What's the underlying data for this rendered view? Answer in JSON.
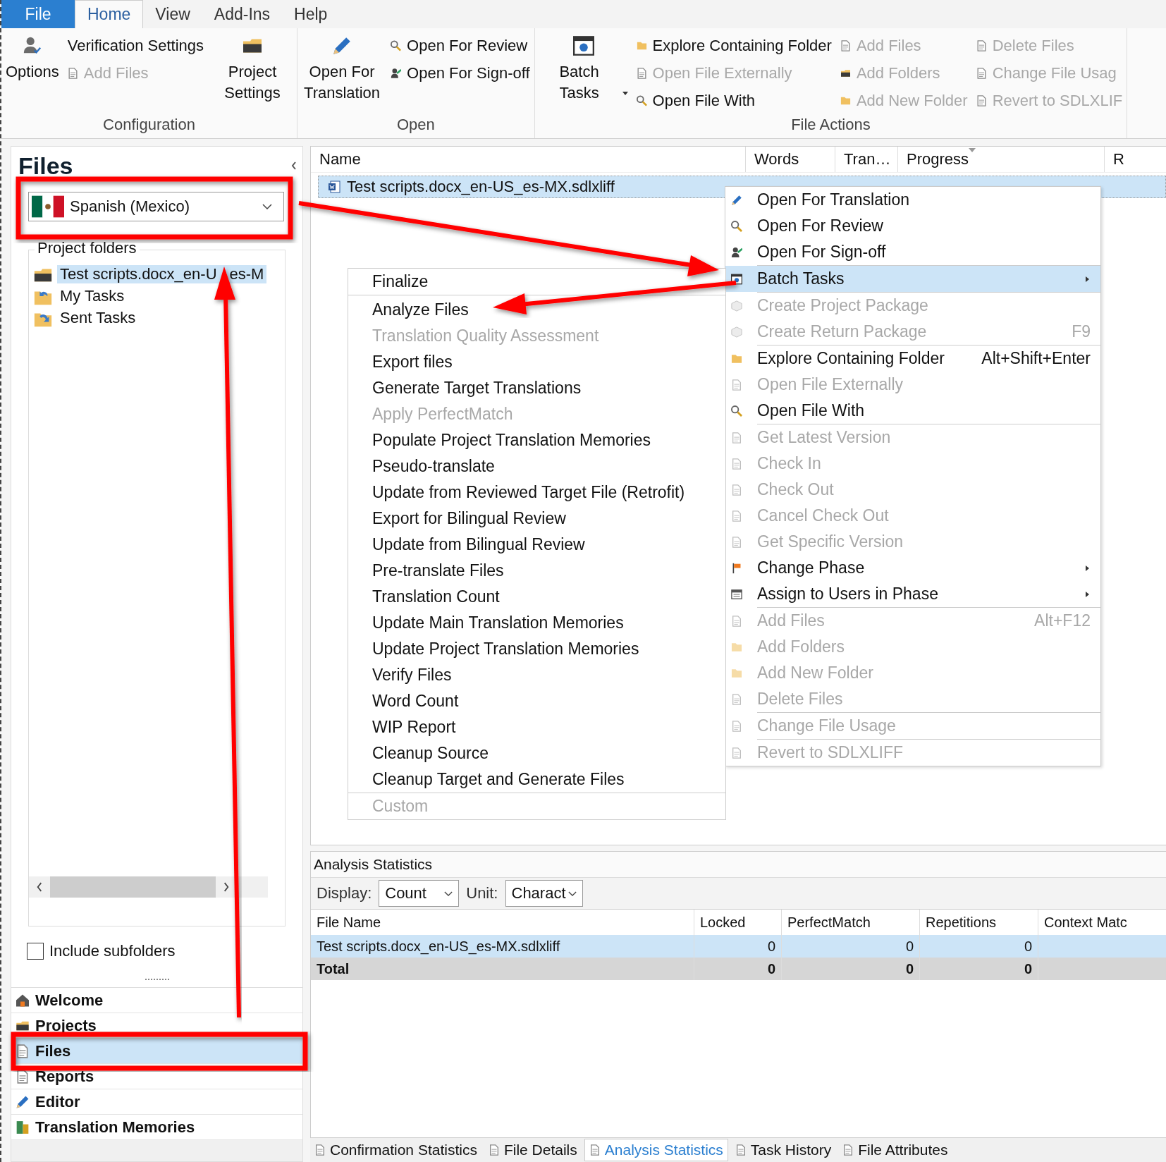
{
  "ribbon": {
    "tabs": [
      {
        "label": "File",
        "kind": "file",
        "selected": false
      },
      {
        "label": "Home",
        "kind": "tab",
        "selected": true
      },
      {
        "label": "View",
        "kind": "tab",
        "selected": false
      },
      {
        "label": "Add-Ins",
        "kind": "tab",
        "selected": false
      },
      {
        "label": "Help",
        "kind": "tab",
        "selected": false
      }
    ],
    "groups": [
      {
        "label": "Configuration",
        "columns": [
          [
            {
              "label": "Options",
              "kind": "large",
              "disabled": false,
              "has_menu": false
            }
          ],
          [
            {
              "label": "Verification Settings",
              "kind": "text",
              "disabled": false,
              "has_menu": false
            },
            {
              "label": "Add Files",
              "kind": "small",
              "disabled": true,
              "has_menu": false
            }
          ],
          [
            {
              "label": "Project Settings",
              "kind": "large",
              "disabled": false,
              "has_menu": false
            }
          ]
        ]
      },
      {
        "label": "Open",
        "columns": [
          [
            {
              "label": "Open For Translation",
              "kind": "large",
              "disabled": false,
              "has_menu": false
            }
          ],
          [
            {
              "label": "Open For Review",
              "kind": "small",
              "disabled": false,
              "has_menu": false
            },
            {
              "label": "Open For Sign-off",
              "kind": "small",
              "disabled": false,
              "has_menu": false
            }
          ]
        ]
      },
      {
        "label": "File Actions",
        "columns": [
          [
            {
              "label": "Batch Tasks",
              "kind": "large",
              "disabled": false,
              "has_menu": true
            }
          ],
          [
            {
              "label": "Explore Containing Folder",
              "kind": "small",
              "disabled": false,
              "has_menu": false
            },
            {
              "label": "Open File Externally",
              "kind": "small",
              "disabled": true,
              "has_menu": false
            },
            {
              "label": "Open File With",
              "kind": "small",
              "disabled": false,
              "has_menu": false
            }
          ],
          [
            {
              "label": "Add Files",
              "kind": "small",
              "disabled": true,
              "has_menu": false
            },
            {
              "label": "Add Folders",
              "kind": "small",
              "disabled": true,
              "has_menu": false
            },
            {
              "label": "Add New Folder",
              "kind": "small",
              "disabled": true,
              "has_menu": false
            }
          ],
          [
            {
              "label": "Delete Files",
              "kind": "small",
              "disabled": true,
              "has_menu": false
            },
            {
              "label": "Change File Usag",
              "kind": "small",
              "disabled": true,
              "has_menu": false
            },
            {
              "label": "Revert to SDLXLIF",
              "kind": "small",
              "disabled": true,
              "has_menu": false
            }
          ]
        ]
      }
    ]
  },
  "files_panel": {
    "title": "Files",
    "language": "Spanish (Mexico)",
    "folders_label": "Project folders",
    "tree": [
      {
        "label": "Test scripts.docx_en-U",
        "kind": "project",
        "selected": true
      },
      {
        "label": "es-M",
        "kind": "continued"
      },
      {
        "label": "My Tasks",
        "kind": "my",
        "selected": false
      },
      {
        "label": "Sent Tasks",
        "kind": "sent",
        "selected": false
      }
    ],
    "include_subfolders": {
      "label": "Include subfolders",
      "checked": false
    },
    "nav": [
      {
        "label": "Welcome",
        "selected": false
      },
      {
        "label": "Projects",
        "selected": false
      },
      {
        "label": "Files",
        "selected": true
      },
      {
        "label": "Reports",
        "selected": false
      },
      {
        "label": "Editor",
        "selected": false
      },
      {
        "label": "Translation Memories",
        "selected": false
      }
    ]
  },
  "file_list": {
    "columns": [
      "Name",
      "Words",
      "Tran…",
      "Progress",
      "R"
    ],
    "rows": [
      {
        "name": "Test scripts.docx_en-US_es-MX.sdlxliff",
        "selected": true
      }
    ]
  },
  "context_menu": {
    "sections": [
      [
        {
          "label": "Open For Translation",
          "disabled": false,
          "selected": false,
          "submenu": false
        },
        {
          "label": "Open For Review",
          "disabled": false,
          "selected": false,
          "submenu": false
        },
        {
          "label": "Open For Sign-off",
          "disabled": false,
          "selected": false,
          "submenu": false
        }
      ],
      [
        {
          "label": "Batch Tasks",
          "disabled": false,
          "selected": true,
          "submenu": true
        }
      ],
      [
        {
          "label": "Create Project Package",
          "disabled": true,
          "selected": false,
          "submenu": false
        },
        {
          "label": "Create Return Package",
          "shortcut": "F9",
          "disabled": true,
          "selected": false,
          "submenu": false
        }
      ],
      [
        {
          "label": "Explore Containing Folder",
          "shortcut": "Alt+Shift+Enter",
          "disabled": false,
          "selected": false,
          "submenu": false
        },
        {
          "label": "Open File Externally",
          "disabled": true,
          "selected": false,
          "submenu": false
        },
        {
          "label": "Open File With",
          "disabled": false,
          "selected": false,
          "submenu": false
        }
      ],
      [
        {
          "label": "Get Latest Version",
          "disabled": true,
          "selected": false,
          "submenu": false
        },
        {
          "label": "Check In",
          "disabled": true,
          "selected": false,
          "submenu": false
        },
        {
          "label": "Check Out",
          "disabled": true,
          "selected": false,
          "submenu": false
        },
        {
          "label": "Cancel Check Out",
          "disabled": true,
          "selected": false,
          "submenu": false
        },
        {
          "label": "Get Specific Version",
          "disabled": true,
          "selected": false,
          "submenu": false
        },
        {
          "label": "Change Phase",
          "disabled": false,
          "selected": false,
          "submenu": true
        },
        {
          "label": "Assign to Users in Phase",
          "disabled": false,
          "selected": false,
          "submenu": true
        }
      ],
      [
        {
          "label": "Add Files",
          "shortcut": "Alt+F12",
          "disabled": true,
          "selected": false,
          "submenu": false
        },
        {
          "label": "Add Folders",
          "disabled": true,
          "selected": false,
          "submenu": false
        },
        {
          "label": "Add New Folder",
          "disabled": true,
          "selected": false,
          "submenu": false
        },
        {
          "label": "Delete Files",
          "disabled": true,
          "selected": false,
          "submenu": false
        }
      ],
      [
        {
          "label": "Change File Usage",
          "disabled": true,
          "selected": false,
          "submenu": false
        }
      ],
      [
        {
          "label": "Revert to SDLXLIFF",
          "disabled": true,
          "selected": false,
          "submenu": false
        }
      ]
    ]
  },
  "batch_submenu": {
    "sections": [
      [
        {
          "label": "Finalize",
          "disabled": false
        }
      ],
      [
        {
          "label": "Analyze Files",
          "disabled": false
        },
        {
          "label": "Translation Quality Assessment",
          "disabled": true
        },
        {
          "label": "Export files",
          "disabled": false
        },
        {
          "label": "Generate Target Translations",
          "disabled": false
        },
        {
          "label": "Apply PerfectMatch",
          "disabled": true
        },
        {
          "label": "Populate Project Translation Memories",
          "disabled": false
        },
        {
          "label": "Pseudo-translate",
          "disabled": false
        },
        {
          "label": "Update from Reviewed Target File (Retrofit)",
          "disabled": false
        },
        {
          "label": "Export for Bilingual Review",
          "disabled": false
        },
        {
          "label": "Update from Bilingual Review",
          "disabled": false
        },
        {
          "label": "Pre-translate Files",
          "disabled": false
        },
        {
          "label": "Translation Count",
          "disabled": false
        },
        {
          "label": "Update Main Translation Memories",
          "disabled": false
        },
        {
          "label": "Update Project Translation Memories",
          "disabled": false
        },
        {
          "label": "Verify Files",
          "disabled": false
        },
        {
          "label": "Word Count",
          "disabled": false
        },
        {
          "label": "WIP Report",
          "disabled": false
        },
        {
          "label": "Cleanup Source",
          "disabled": false
        },
        {
          "label": "Cleanup Target and Generate Files",
          "disabled": false
        }
      ],
      [
        {
          "label": "Custom",
          "disabled": true
        }
      ]
    ]
  },
  "analysis": {
    "title": "Analysis Statistics",
    "display_label": "Display:",
    "display_value": "Count",
    "unit_label": "Unit:",
    "unit_value": "Charact",
    "columns": [
      "File Name",
      "Locked",
      "PerfectMatch",
      "Repetitions",
      "Context Matc"
    ],
    "rows": [
      {
        "kind": "file",
        "selected": true,
        "cells": [
          "Test scripts.docx_en-US_es-MX.sdlxliff",
          "0",
          "0",
          "0"
        ]
      },
      {
        "kind": "total",
        "selected": false,
        "cells": [
          "Total",
          "0",
          "0",
          "0"
        ]
      }
    ]
  },
  "bottom_tabs": [
    {
      "label": "Confirmation Statistics",
      "selected": false
    },
    {
      "label": "File Details",
      "selected": false
    },
    {
      "label": "Analysis Statistics",
      "selected": true
    },
    {
      "label": "Task History",
      "selected": false
    },
    {
      "label": "File Attributes",
      "selected": false
    }
  ]
}
